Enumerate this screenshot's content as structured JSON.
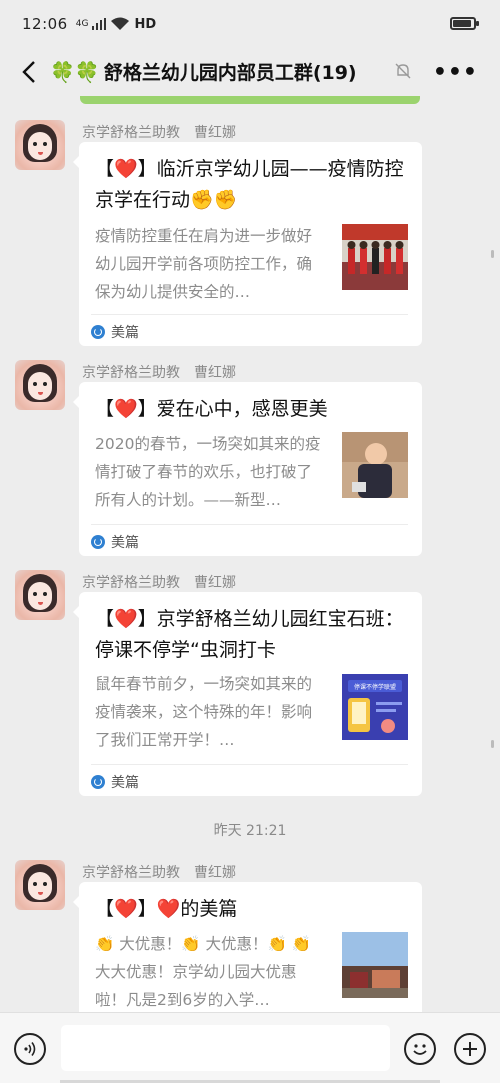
{
  "status_bar": {
    "time": "12:06",
    "signal": "4G",
    "network": "HD"
  },
  "nav": {
    "title": "舒格兰幼儿园内部员工群(19)",
    "clovers": "🍀🍀"
  },
  "messages": [
    {
      "sender": "京学舒格兰助教　曹红娜",
      "title": "【❤️】临沂京学幼儿园——疫情防控 京学在行动✊✊",
      "description": "疫情防控重任在肩为进一步做好幼儿园开学前各项防控工作，确保为幼儿提供安全的…",
      "source": "美篇"
    },
    {
      "sender": "京学舒格兰助教　曹红娜",
      "title": "【❤️】爱在心中，感恩更美",
      "description": "2020的春节，一场突如其来的疫情打破了春节的欢乐，也打破了所有人的计划。——新型…",
      "source": "美篇"
    },
    {
      "sender": "京学舒格兰助教　曹红娜",
      "title": "【❤️】京学舒格兰幼儿园红宝石班：停课不停学“虫洞打卡",
      "description": "鼠年春节前夕，一场突如其来的疫情袭来，这个特殊的年！影响了我们正常开学！…",
      "source": "美篇"
    },
    {
      "sender": "京学舒格兰助教　曹红娜",
      "title": "【❤️】❤️的美篇",
      "description": "👏 大优惠！👏 大优惠！👏 👏 大大优惠！京学幼儿园大优惠啦！凡是2到6岁的入学…",
      "source": "美篇"
    }
  ],
  "timestamp": "昨天 21:21",
  "thumb3_text": "停课不停学联盟"
}
